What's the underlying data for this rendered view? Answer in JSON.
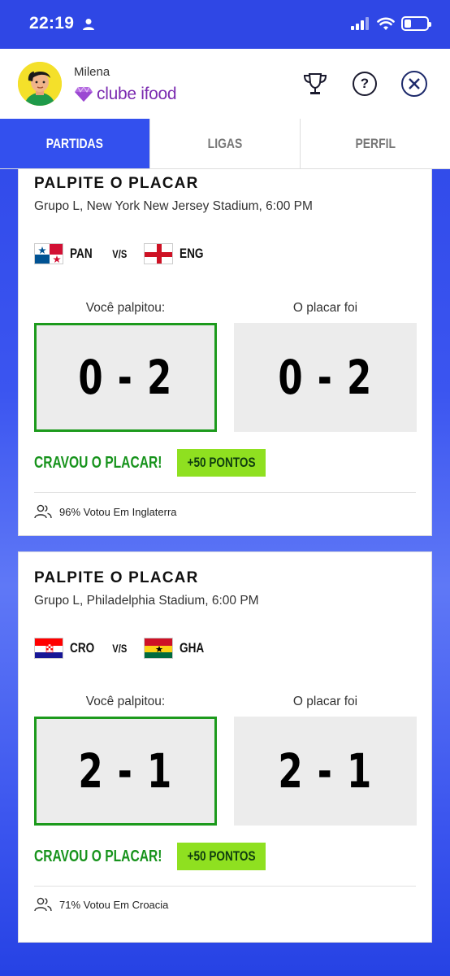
{
  "status_bar": {
    "time": "22:19"
  },
  "header": {
    "user_name": "Milena",
    "club_name": "clube ifood"
  },
  "tabs": [
    {
      "label": "PARTIDAS",
      "active": true
    },
    {
      "label": "LIGAS",
      "active": false
    },
    {
      "label": "PERFIL",
      "active": false
    }
  ],
  "matches": [
    {
      "title": "PALPITE O PLACAR",
      "subtitle": "Grupo L, New York New Jersey Stadium, 6:00 PM",
      "home": "PAN",
      "away": "ENG",
      "vs": "V/S",
      "guess_label": "Você palpitou:",
      "guess": "0 - 2",
      "result_label": "O placar foi",
      "result": "0 - 2",
      "outcome": "CRAVOU O PLACAR!",
      "points": "+50 PONTOS",
      "vote_text": "96% Votou Em Inglaterra"
    },
    {
      "title": "PALPITE O PLACAR",
      "subtitle": "Grupo L, Philadelphia Stadium, 6:00 PM",
      "home": "CRO",
      "away": "GHA",
      "vs": "V/S",
      "guess_label": "Você palpitou:",
      "guess": "2 - 1",
      "result_label": "O placar foi",
      "result": "2 - 1",
      "outcome": "CRAVOU O PLACAR!",
      "points": "+50 PONTOS",
      "vote_text": "71% Votou Em Croacia"
    }
  ],
  "colors": {
    "brand_blue": "#3350ee",
    "success_green": "#17931c",
    "points_green": "#8fe020",
    "club_purple": "#7b2bb0"
  }
}
